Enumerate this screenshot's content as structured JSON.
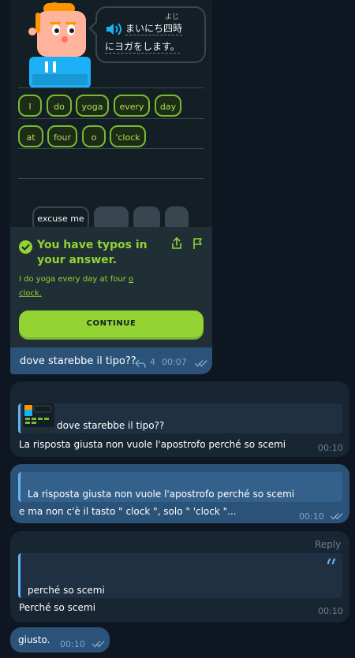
{
  "screenshot": {
    "speech": {
      "furigana": "よじ",
      "line1": "まいにち四時",
      "line2": "にヨガをします。"
    },
    "answer_words_row1": [
      "I",
      "do",
      "yoga",
      "every",
      "day"
    ],
    "answer_words_row2": [
      "at",
      "four",
      "o",
      "'clock"
    ],
    "word_bank": [
      "excuse me"
    ],
    "feedback": {
      "title": "You have typos in your answer.",
      "text_plain": "I do yoga every day at four ",
      "text_underlined_1": "o",
      "text_underlined_2": "clock.",
      "continue_label": "CONTINUE"
    },
    "colors": {
      "accent_green": "#93d333",
      "chip_border": "#79b933",
      "background": "#131f24"
    }
  },
  "messages": {
    "m1": {
      "text": "dove starebbe il tipo??",
      "reply_count": "4",
      "time": "00:07"
    },
    "m2": {
      "quote": "dove starebbe il tipo??",
      "text": "La risposta giusta non vuole l'apostrofo perché so scemi",
      "time": "00:10"
    },
    "m3": {
      "quote": "La risposta giusta non vuole l'apostrofo perché so scemi",
      "text": "e ma non c'è il tasto \" clock \", solo \" 'clock \"...",
      "time": "00:10"
    },
    "m4": {
      "reply_label": "Reply",
      "quote": "perché so scemi",
      "text": "Perché so scemi",
      "time": "00:10"
    },
    "m5": {
      "text": "giusto.",
      "time": "00:10"
    }
  },
  "icons": [
    "speaker-icon",
    "check-circle-icon",
    "share-icon",
    "flag-icon",
    "reply-arrow-icon",
    "double-check-icon",
    "quote-icon"
  ],
  "colors": {
    "chat_bg": "#0e1621",
    "incoming_bubble": "#182533",
    "outgoing_bubble": "#2b5278",
    "quote_bar": "#64b5ef"
  }
}
